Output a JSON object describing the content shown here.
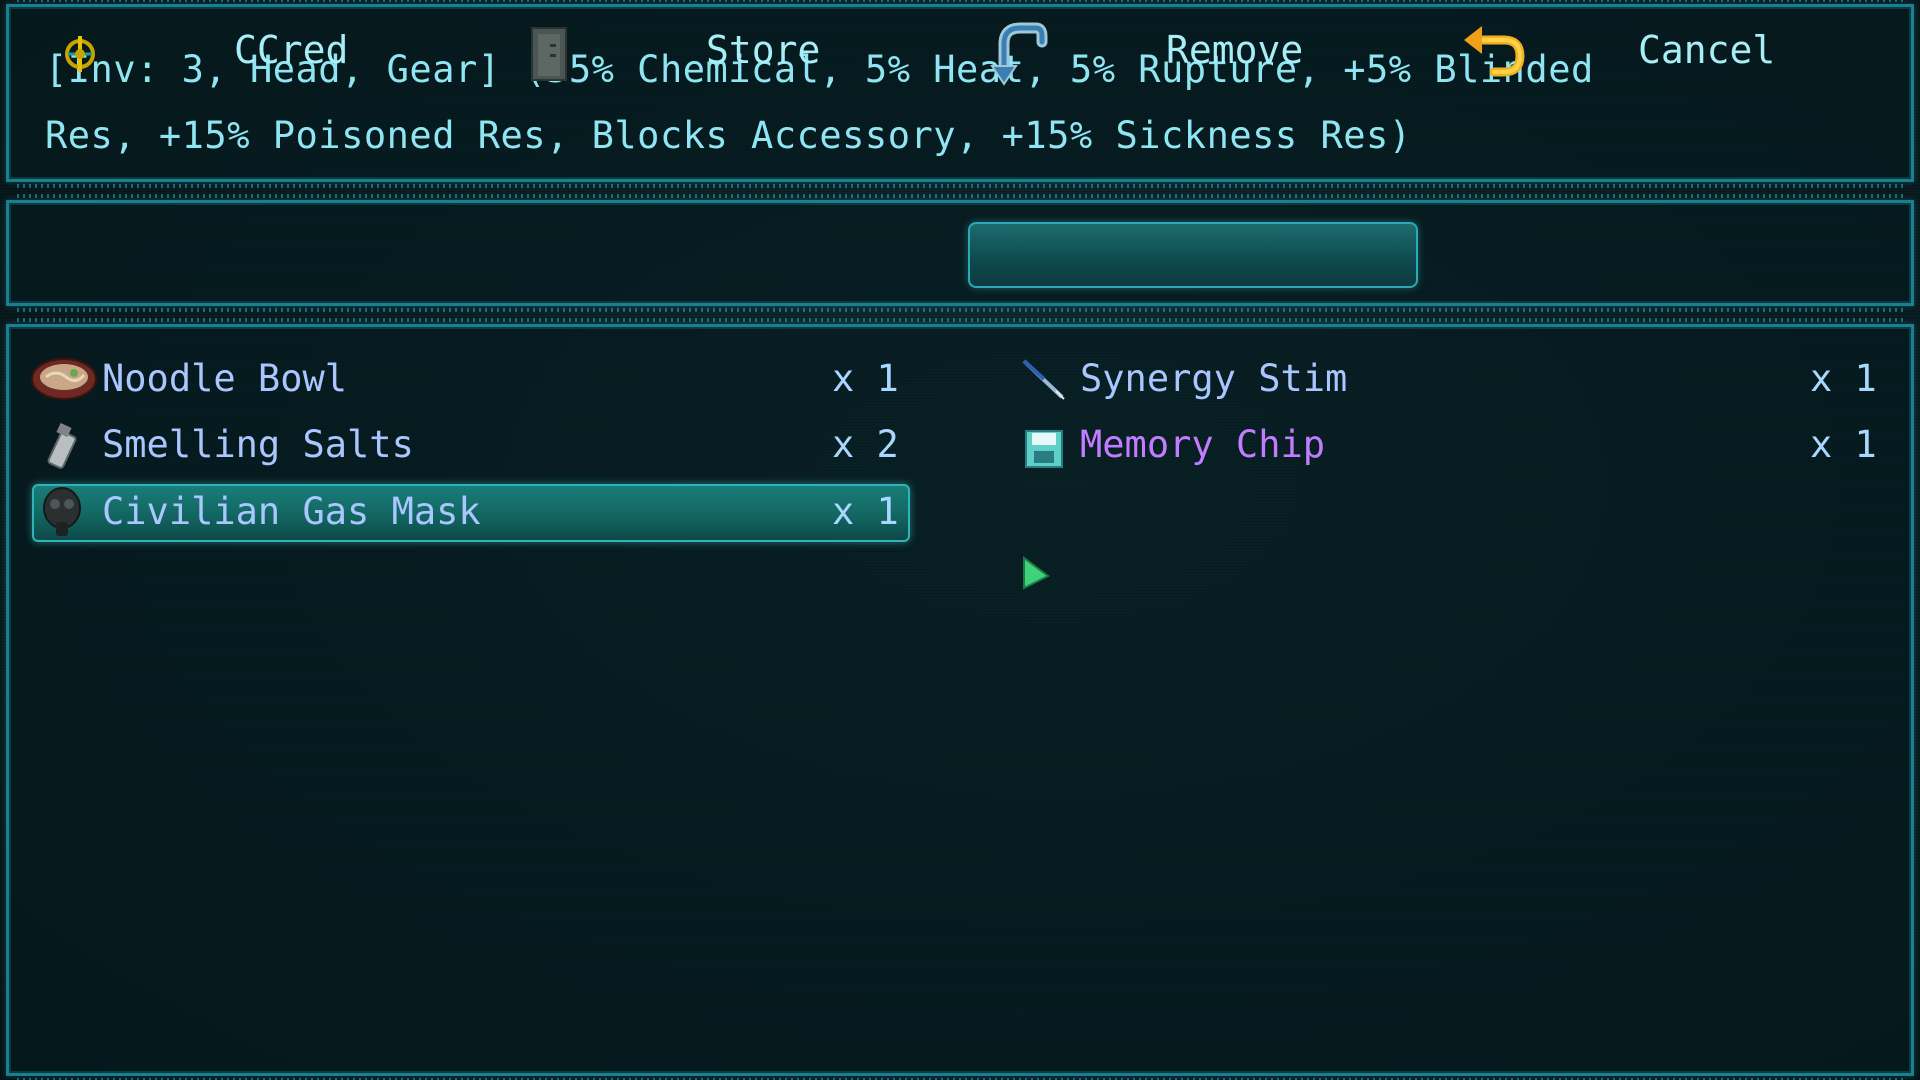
{
  "description": {
    "line1": "[Inv: 3, Head, Gear] (55% Chemical, 5% Heat, 5% Rupture, +5% Blinded",
    "line2": "Res, +15% Poisoned Res, Blocks Accessory, +15% Sickness Res)"
  },
  "actions": {
    "ccred": {
      "label": "CCred",
      "icon": "ccred-coin-icon"
    },
    "store": {
      "label": "Store",
      "icon": "locker-icon"
    },
    "remove": {
      "label": "Remove",
      "icon": "remove-arrow-icon",
      "selected": true
    },
    "cancel": {
      "label": "Cancel",
      "icon": "undo-arrow-icon"
    }
  },
  "inventory": {
    "left": [
      {
        "name": "Noodle Bowl",
        "qty": "x 1",
        "icon": "noodle-bowl-icon"
      },
      {
        "name": "Smelling Salts",
        "qty": "x 2",
        "icon": "smelling-salts-icon"
      },
      {
        "name": "Civilian Gas Mask",
        "qty": "x 1",
        "icon": "gas-mask-icon",
        "selected": true
      }
    ],
    "right": [
      {
        "name": "Synergy Stim",
        "qty": "x 1",
        "icon": "stim-syringe-icon"
      },
      {
        "name": "Memory Chip",
        "qty": "x 1",
        "icon": "memory-chip-icon",
        "color": "#c27cff"
      }
    ]
  },
  "colors": {
    "frame": "#1a7f8e",
    "text": "#8fe6f2",
    "item_text": "#a9c6ff",
    "rare_item": "#c27cff",
    "selection": "#1a7d78"
  }
}
